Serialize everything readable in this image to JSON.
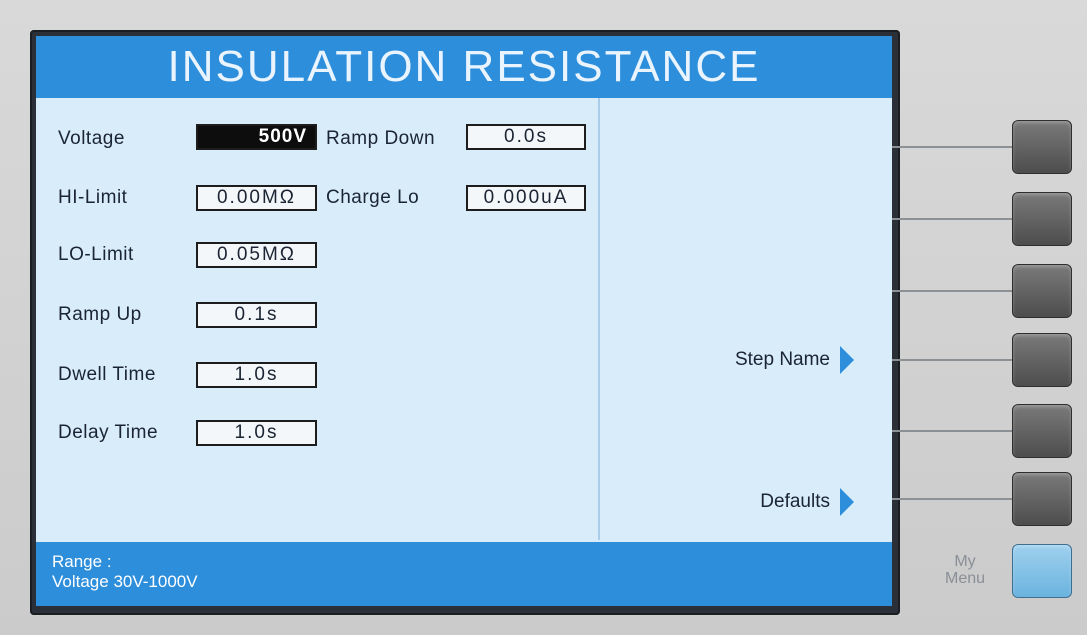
{
  "title": "INSULATION RESISTANCE",
  "params": {
    "voltage": {
      "label": "Voltage",
      "value": "500V"
    },
    "hi_limit": {
      "label": "HI-Limit",
      "value": "0.00MΩ"
    },
    "lo_limit": {
      "label": "LO-Limit",
      "value": "0.05MΩ"
    },
    "ramp_up": {
      "label": "Ramp Up",
      "value": "0.1s"
    },
    "dwell_time": {
      "label": "Dwell Time",
      "value": "1.0s"
    },
    "delay_time": {
      "label": "Delay Time",
      "value": "1.0s"
    },
    "ramp_down": {
      "label": "Ramp Down",
      "value": "0.0s"
    },
    "charge_lo": {
      "label": "Charge Lo",
      "value": "0.000uA"
    }
  },
  "softkeys": {
    "step_name": "Step Name",
    "defaults": "Defaults"
  },
  "status": {
    "line1": "Range :",
    "line2": "Voltage 30V-1000V"
  },
  "hardware": {
    "my_menu_line1": "My",
    "my_menu_line2": "Menu"
  },
  "colors": {
    "accent": "#2d8edb",
    "screen_bg": "#d8ecfa",
    "menu_key": "#6bb3df"
  },
  "icons": {
    "softkey_arrow": "triangle-right-icon"
  }
}
